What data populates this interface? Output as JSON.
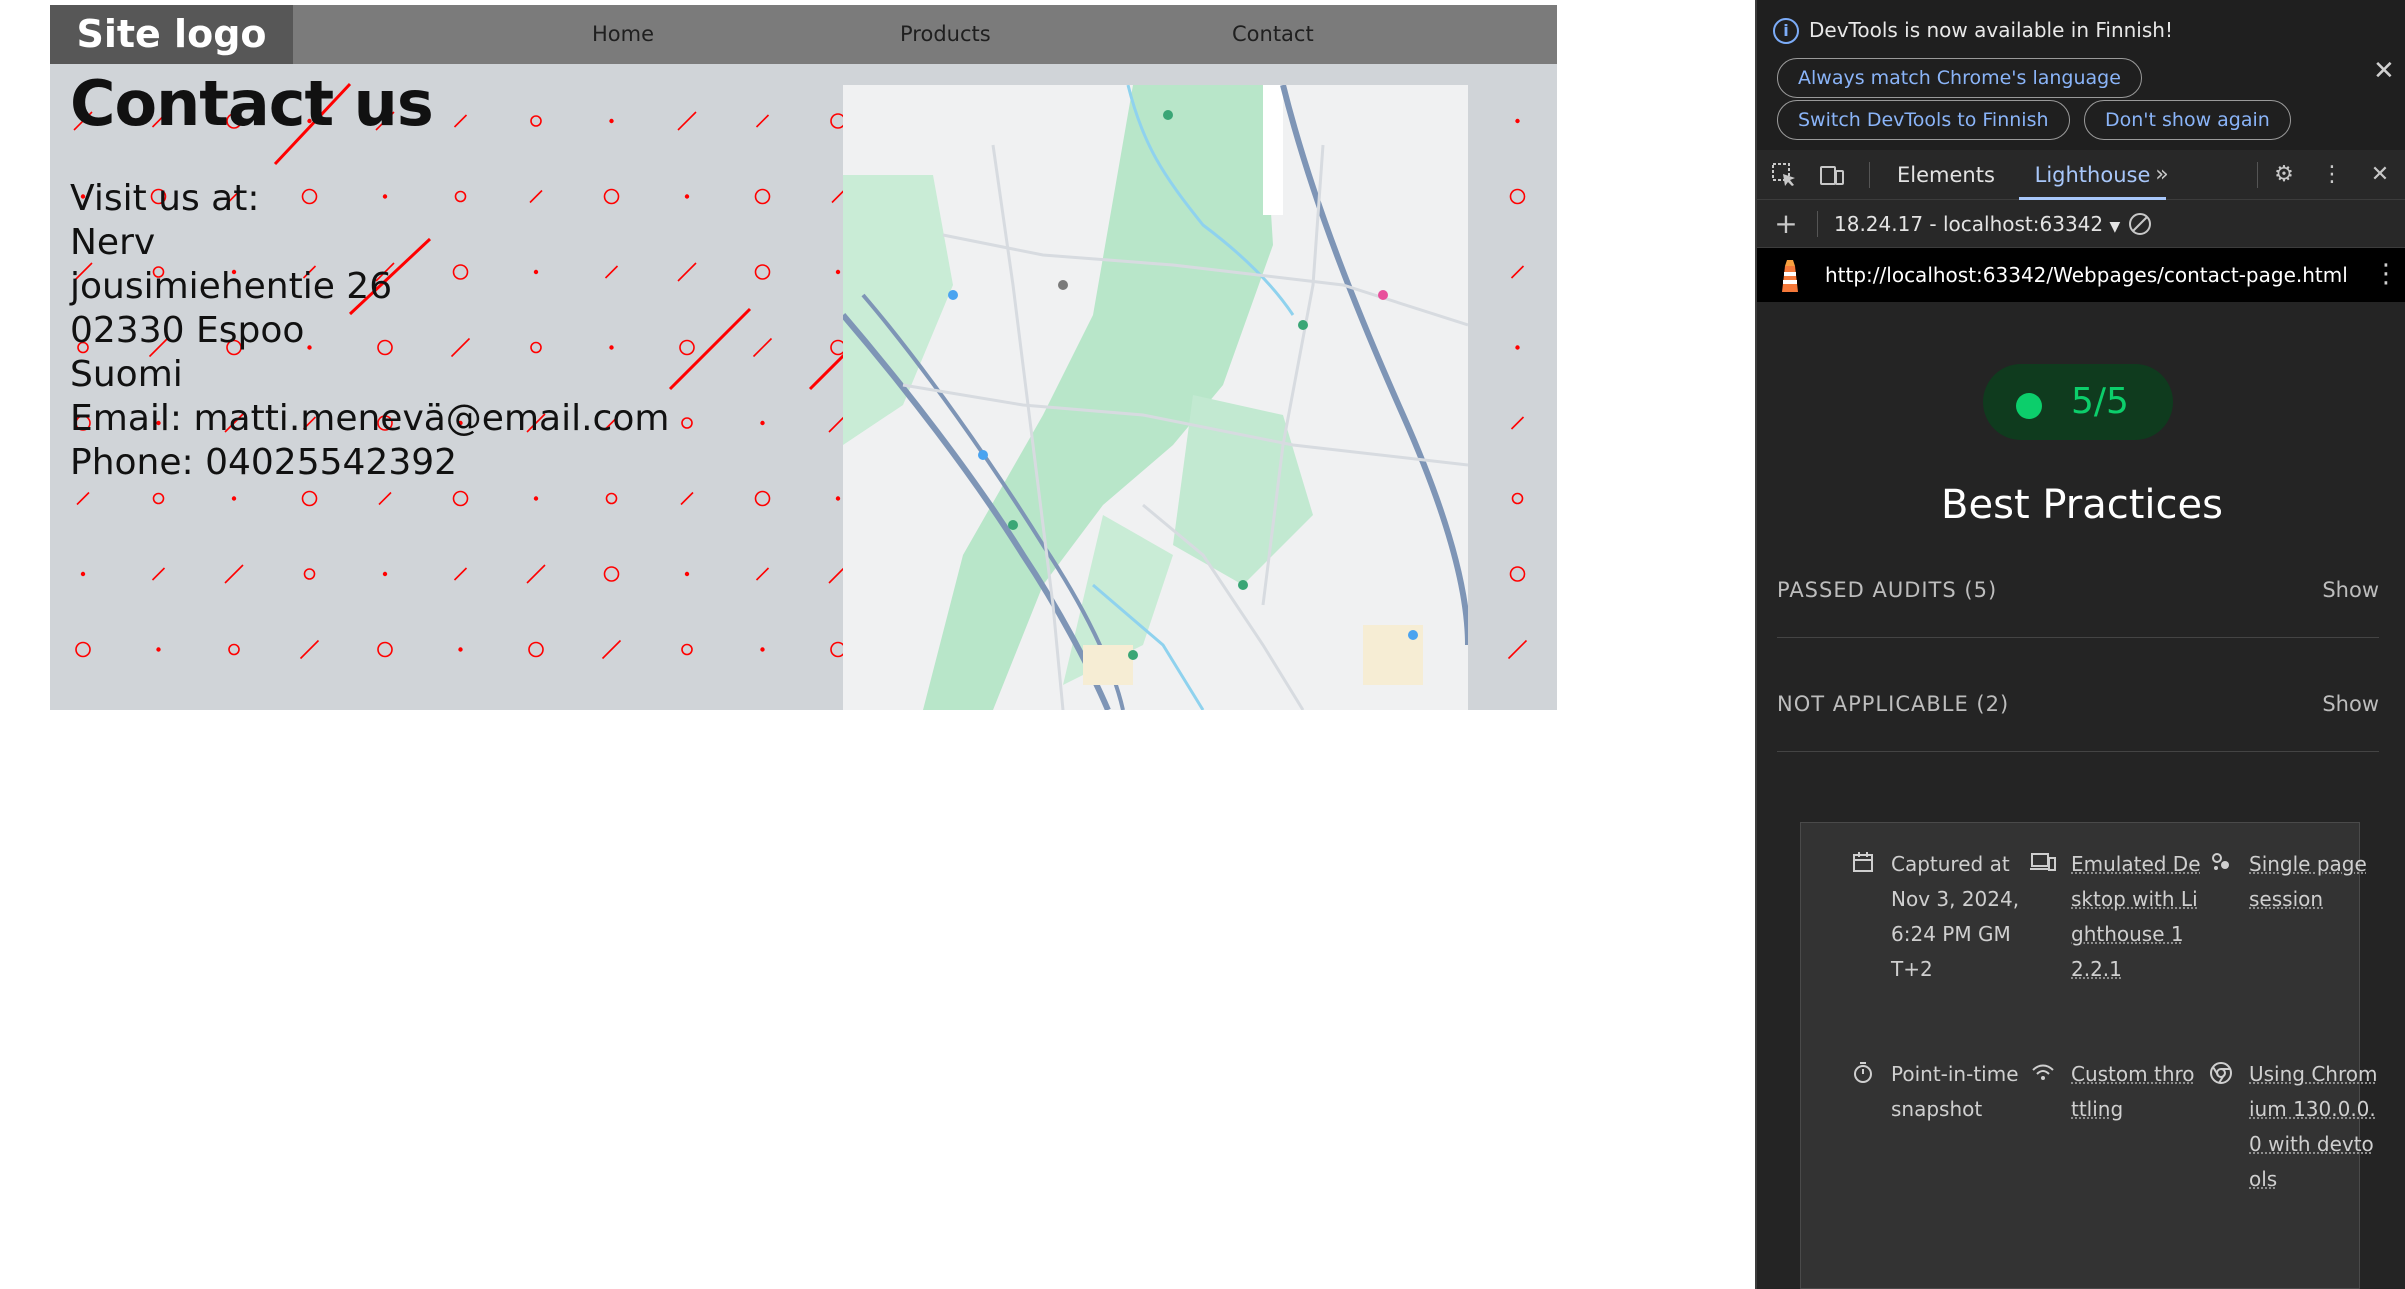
{
  "site": {
    "logo": "Site logo",
    "nav": [
      "Home",
      "Products",
      "Contact"
    ],
    "title": "Contact us",
    "lines": [
      "Visit us at:",
      "Nerv",
      "jousimiehentie 26",
      "02330 Espoo",
      "Suomi",
      "Email: matti.menevä@email.com",
      "Phone: 04025542392"
    ],
    "colors": {
      "nav": "#7b7b7b",
      "logo_bg": "#575757",
      "page_bg": "#d0d4d8",
      "pattern": "#ff0000"
    }
  },
  "devtools": {
    "infobar": {
      "message": "DevTools is now available in Finnish!",
      "buttons": [
        "Always match Chrome's language",
        "Switch DevTools to Finnish",
        "Don't show again"
      ]
    },
    "tabs": [
      "Elements",
      "Lighthouse"
    ],
    "active_tab": "Lighthouse",
    "report_select": "18.24.17 - localhost:63342",
    "url": "http://localhost:63342/Webpages/contact-page.html",
    "score": "5/5",
    "category": "Best Practices",
    "groups": [
      {
        "label": "PASSED AUDITS (5)",
        "action": "Show"
      },
      {
        "label": "NOT APPLICABLE (2)",
        "action": "Show"
      }
    ],
    "meta": {
      "captured": "Captured at Nov 3, 2024, 6:24 PM GMT+2",
      "device": "Emulated Desktop with Lighthouse 12.2.1",
      "session": "Single page session",
      "snapshot": "Point-in-time snapshot",
      "throttling": "Custom throttling",
      "browser": "Using Chromium 130.0.0.0 with devtools"
    },
    "colors": {
      "score": "#0cce6b",
      "accent": "#a8c7fa",
      "link": "#8ab4f8"
    }
  }
}
